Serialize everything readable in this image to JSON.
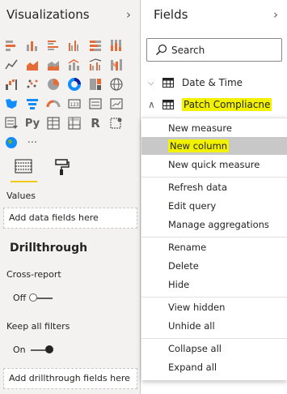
{
  "visualizations": {
    "title": "Visualizations",
    "collapse_icon": "chevron-right-icon",
    "tabs": [
      {
        "name": "fields-tab",
        "icon": "table-fields-icon",
        "active": true
      },
      {
        "name": "format-tab",
        "icon": "paint-roller-icon",
        "active": false
      }
    ],
    "values_label": "Values",
    "values_placeholder": "Add data fields here",
    "drillthrough_heading": "Drillthrough",
    "cross_report_label": "Cross-report",
    "cross_report_state": "Off",
    "keep_filters_label": "Keep all filters",
    "keep_filters_state": "On",
    "drillthrough_placeholder": "Add drillthrough fields here",
    "more_label": "···",
    "python_label": "Py",
    "r_label": "R"
  },
  "fields": {
    "title": "Fields",
    "collapse_icon": "chevron-right-icon",
    "search_placeholder": "Search",
    "tables": [
      {
        "name": "Date & Time",
        "expanded": false,
        "highlighted": false
      },
      {
        "name": "Patch Compliacne",
        "expanded": true,
        "highlighted": true
      }
    ]
  },
  "context_menu": {
    "items": [
      {
        "label": "New measure",
        "active": false
      },
      {
        "label": "New column",
        "active": true,
        "highlighted": true
      },
      {
        "label": "New quick measure",
        "active": false
      },
      {
        "label": "Refresh data",
        "active": false
      },
      {
        "label": "Edit query",
        "active": false
      },
      {
        "label": "Manage aggregations",
        "active": false
      },
      {
        "label": "Rename",
        "active": false
      },
      {
        "label": "Delete",
        "active": false
      },
      {
        "label": "Hide",
        "active": false
      },
      {
        "label": "View hidden",
        "active": false
      },
      {
        "label": "Unhide all",
        "active": false
      },
      {
        "label": "Collapse all",
        "active": false
      },
      {
        "label": "Expand all",
        "active": false
      }
    ]
  },
  "colors": {
    "accent_yellow": "#f2c811",
    "highlight_yellow": "#f2f200",
    "pane_bg": "#f3f2f1",
    "menu_active": "#c8c8c8"
  }
}
